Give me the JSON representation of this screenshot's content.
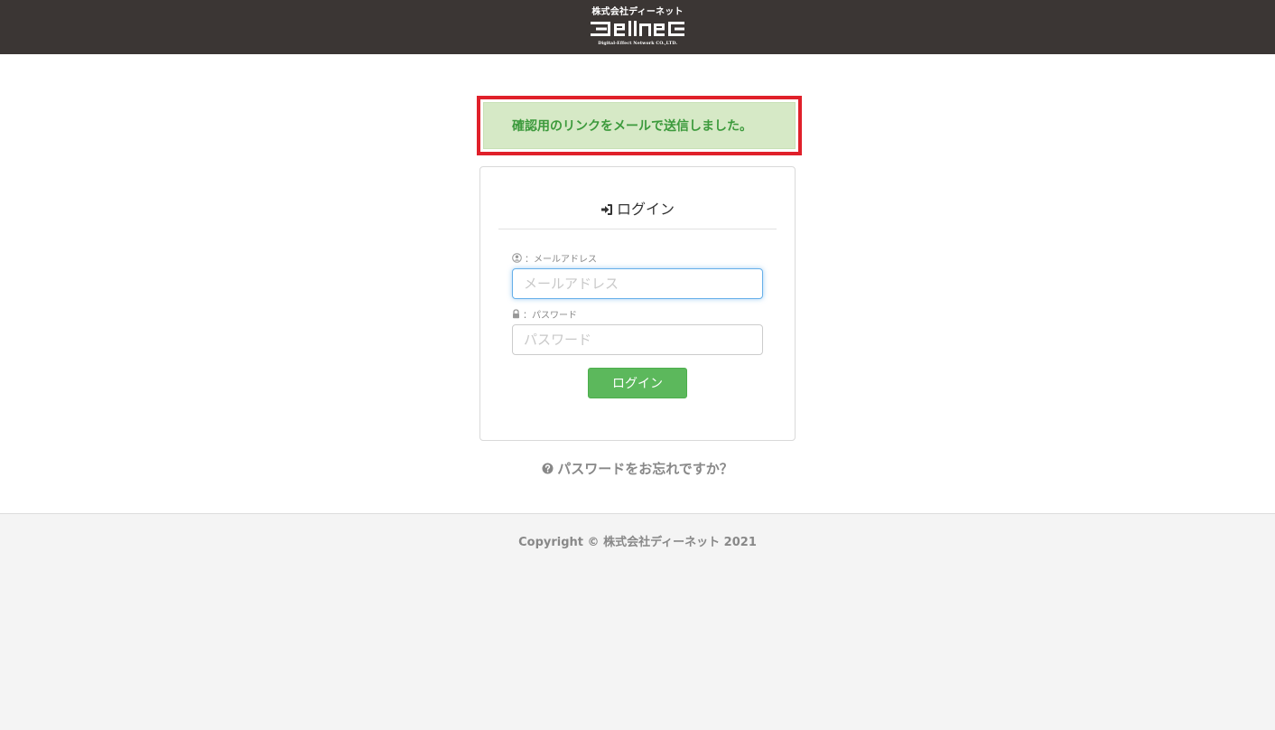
{
  "header": {
    "logo_company": "株式会社ディーネット",
    "logo_tagline": "Digital-Effect Network CO.,LTD."
  },
  "alert": {
    "message": "確認用のリンクをメールで送信しました。"
  },
  "login_panel": {
    "title": "ログイン",
    "email_label": "：メールアドレス",
    "email_placeholder": "メールアドレス",
    "email_value": "",
    "password_label": "：パスワード",
    "password_placeholder": "パスワード",
    "password_value": "",
    "login_button": "ログイン"
  },
  "forgot_password": {
    "label": "パスワードをお忘れですか？"
  },
  "footer": {
    "copyright": "Copyright © 株式会社ディーネット 2021"
  },
  "icons": {
    "title": "sign-in-icon",
    "email": "user-circle-icon",
    "password": "lock-icon",
    "forgot": "question-circle-icon"
  },
  "colors": {
    "header_bg": "#3b3634",
    "alert_bg": "#d6e9c6",
    "alert_text": "#3c9a3c",
    "highlight_border": "#e0202a",
    "button_bg": "#5cb85c",
    "focus_border": "#66afe9"
  }
}
